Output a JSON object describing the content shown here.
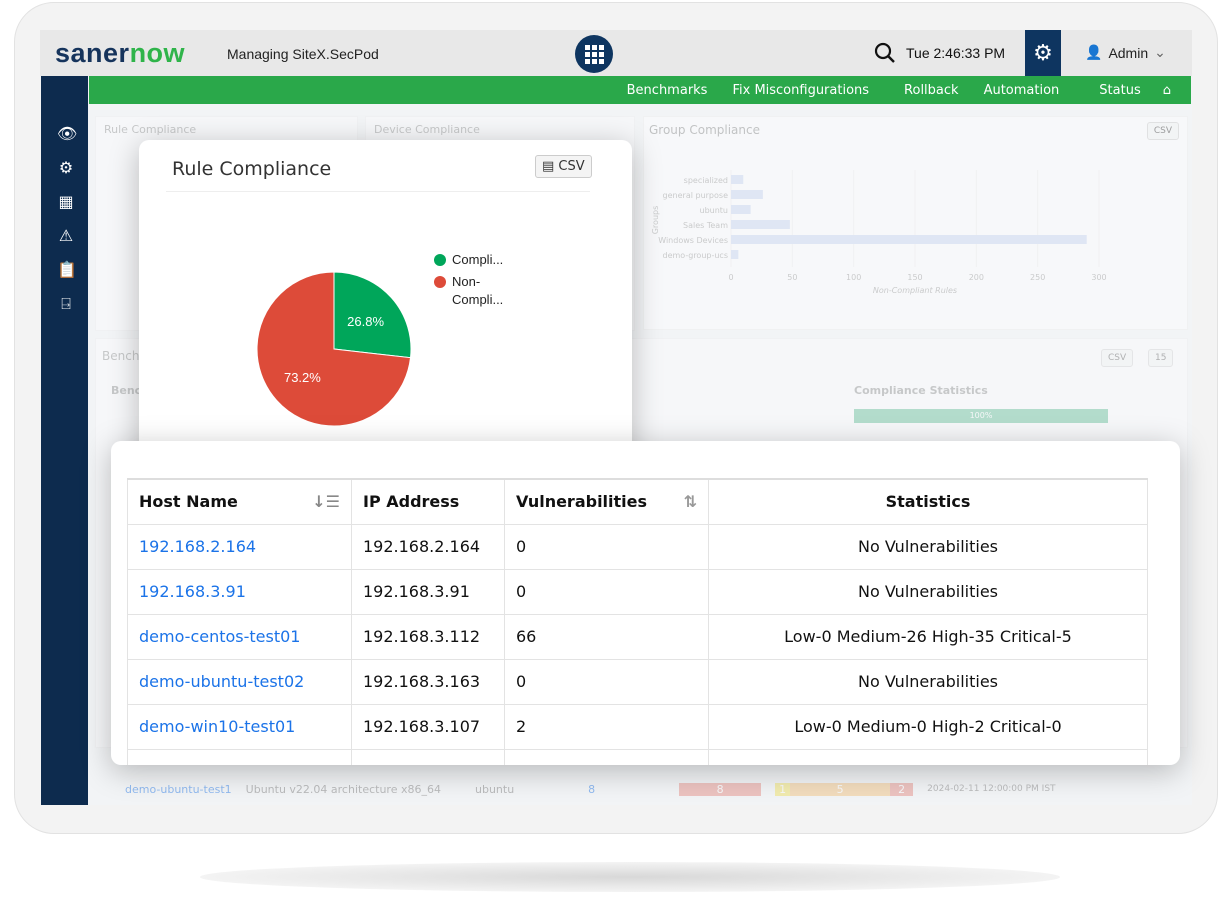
{
  "header": {
    "logo_a": "saner",
    "logo_b": "now",
    "managing": "Managing  SiteX.SecPod",
    "time": "Tue  2:46:33 PM",
    "user": "Admin"
  },
  "nav": [
    "Benchmarks",
    "Fix Misconfigurations",
    "Rollback",
    "Automation",
    "Status"
  ],
  "background": {
    "rule_title": "Rule Compliance",
    "device_title": "Device Compliance",
    "group_title": "Group Compliance",
    "csv": "CSV",
    "bench_title": "Bench",
    "bench_col": "Bench",
    "compliance_stats": "Compliance Statistics",
    "pct": "100%",
    "page_size": "15",
    "row": {
      "host": "demo-ubuntu-test1",
      "os": "Ubuntu v22.04 architecture x86_64",
      "group": "ubuntu",
      "count": "8",
      "red": "8",
      "yellow": "1",
      "orange": "5",
      "red2": "2",
      "date": "2024-02-11 12:00:00 PM IST"
    }
  },
  "group_chart": {
    "type": "bar",
    "orientation": "horizontal",
    "categories": [
      "specialized",
      "general purpose",
      "ubuntu",
      "Sales Team",
      "Windows Devices",
      "demo-group-ucs"
    ],
    "values": [
      10,
      26,
      16,
      48,
      290,
      6
    ],
    "xlabel": "Non-Compliant Rules",
    "ylabel": "Groups",
    "xlim": [
      0,
      300
    ],
    "ticks": [
      "0",
      "50",
      "100",
      "150",
      "200",
      "250",
      "300"
    ],
    "color": "#c9d7f2"
  },
  "chart_data": {
    "type": "pie",
    "title": "Rule Compliance",
    "csv": "CSV",
    "labels": [
      "Compli...",
      "Non-Compli..."
    ],
    "values": [
      26.8,
      73.2
    ],
    "value_labels": [
      "26.8%",
      "73.2%"
    ],
    "colors": [
      "#00a65a",
      "#dd4b39"
    ],
    "legend": "right"
  },
  "table": {
    "headers": [
      "Host Name",
      "IP Address",
      "Vulnerabilities",
      "Statistics"
    ],
    "rows": [
      [
        "192.168.2.164",
        "192.168.2.164",
        "0",
        "No Vulnerabilities"
      ],
      [
        "192.168.3.91",
        "192.168.3.91",
        "0",
        "No Vulnerabilities"
      ],
      [
        "demo-centos-test01",
        "192.168.3.112",
        "66",
        "Low-0 Medium-26 High-35 Critical-5"
      ],
      [
        "demo-ubuntu-test02",
        "192.168.3.163",
        "0",
        "No Vulnerabilities"
      ],
      [
        "demo-win10-test01",
        "192.168.3.107",
        "2",
        "Low-0 Medium-0 High-2 Critical-0"
      ]
    ]
  }
}
